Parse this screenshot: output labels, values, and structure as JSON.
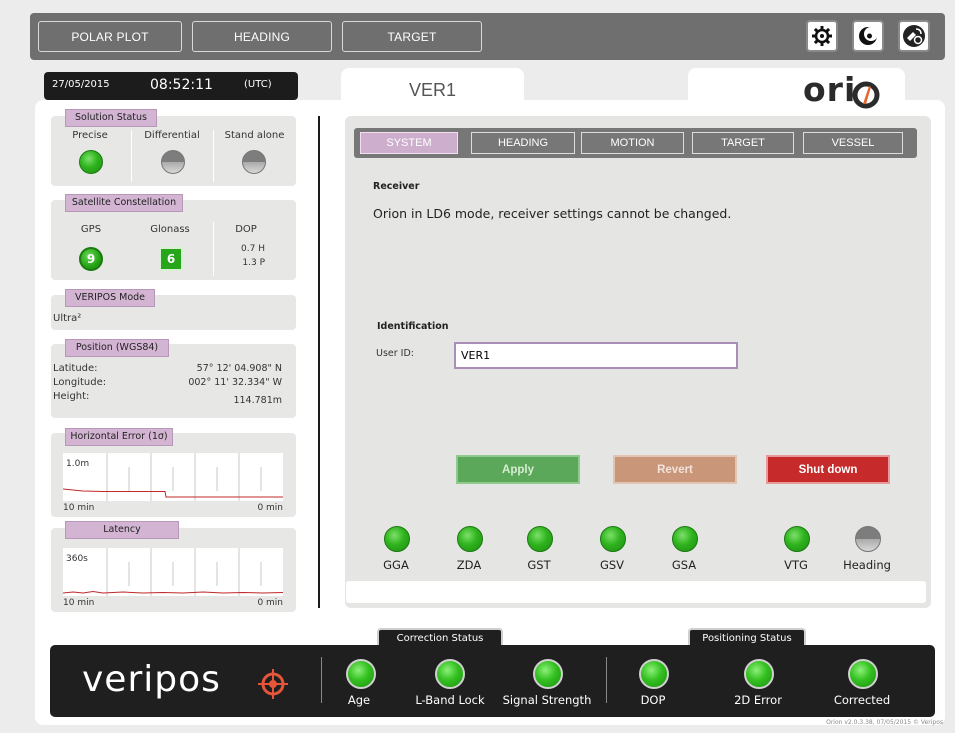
{
  "nav": {
    "polar_plot": "POLAR PLOT",
    "heading": "HEADING",
    "target": "TARGET",
    "icons": [
      "gear-icon",
      "night-mode-icon",
      "antenna-icon"
    ]
  },
  "clock": {
    "date": "27/05/2015",
    "time": "08:52:11",
    "zone": "(UTC)"
  },
  "tabs": {
    "ver1": "VER1",
    "brand": "ori n"
  },
  "solution": {
    "title": "Solution Status",
    "items": [
      {
        "label": "Precise",
        "state": "on"
      },
      {
        "label": "Differential",
        "state": "off"
      },
      {
        "label": "Stand alone",
        "state": "off"
      }
    ]
  },
  "satellites": {
    "title": "Satellite Constellation",
    "gps_label": "GPS",
    "gps_count": "9",
    "glonass_label": "Glonass",
    "glonass_count": "6",
    "dop_label": "DOP",
    "dop_h": "0.7 H",
    "dop_p": "1.3 P"
  },
  "veripos_mode": {
    "title": "VERIPOS Mode",
    "value": "Ultra²"
  },
  "position": {
    "title": "Position  (WGS84)",
    "lat_label": "Latitude:",
    "lat_value": "57°  12' 04.908\"  N",
    "lon_label": "Longitude:",
    "lon_value": "002°  11' 32.334\"  W",
    "height_label": "Height:",
    "height_value": "114.781m"
  },
  "horizontal_error": {
    "title": "Horizontal Error (1σ)",
    "scale": "1.0m",
    "left": "10 min",
    "right": "0 min"
  },
  "latency": {
    "title": "Latency",
    "scale": "360s",
    "left": "10 min",
    "right": "0 min"
  },
  "subtabs": [
    "SYSTEM",
    "HEADING",
    "MOTION",
    "TARGET",
    "VESSEL"
  ],
  "receiver": {
    "title": "Receiver",
    "message": "Orion in LD6 mode, receiver settings cannot be changed."
  },
  "identification": {
    "title": "Identification",
    "user_id_label": "User ID:",
    "user_id_value": "VER1"
  },
  "actions": {
    "apply": "Apply",
    "revert": "Revert",
    "shutdown": "Shut down"
  },
  "nmea": [
    {
      "label": "GGA",
      "state": "on"
    },
    {
      "label": "ZDA",
      "state": "on"
    },
    {
      "label": "GST",
      "state": "on"
    },
    {
      "label": "GSV",
      "state": "on"
    },
    {
      "label": "GSA",
      "state": "on"
    },
    {
      "label": "VTG",
      "state": "on"
    },
    {
      "label": "Heading",
      "state": "off"
    }
  ],
  "bottom": {
    "logo": "veripos",
    "correction_status": "Correction Status",
    "positioning_status": "Positioning Status",
    "correction_items": [
      "Age",
      "L-Band Lock",
      "Signal Strength"
    ],
    "positioning_items": [
      "DOP",
      "2D Error",
      "Corrected"
    ],
    "version": "Orion v2.0.3.38, 07/05/2015 © Veripos"
  },
  "colors": {
    "accent": "#d3b5d3",
    "apply": "#5ca85a",
    "revert": "#c9967a",
    "shutdown": "#c62a2a",
    "led_on": "#2fb31e"
  }
}
